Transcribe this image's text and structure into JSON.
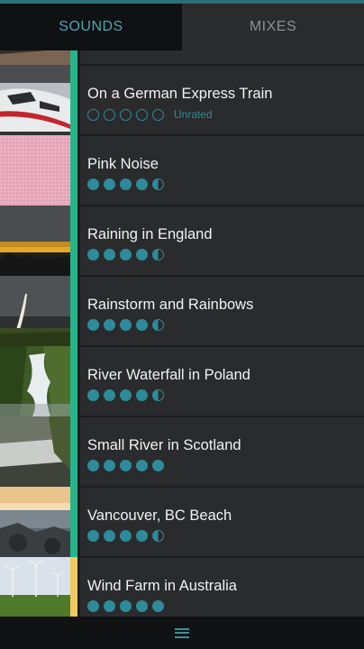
{
  "tabs": {
    "sounds": "SOUNDS",
    "mixes": "MIXES"
  },
  "unrated_label": "Unrated",
  "sounds": [
    {
      "title": "On a German Express Train",
      "rating": [
        0,
        0,
        0,
        0,
        0
      ],
      "unrated": true,
      "bar": "green"
    },
    {
      "title": "Pink Noise",
      "rating": [
        1,
        1,
        1,
        1,
        0.5
      ],
      "unrated": false,
      "bar": "green"
    },
    {
      "title": "Raining in England",
      "rating": [
        1,
        1,
        1,
        1,
        0.5
      ],
      "unrated": false,
      "bar": "green"
    },
    {
      "title": "Rainstorm and Rainbows",
      "rating": [
        1,
        1,
        1,
        1,
        0.5
      ],
      "unrated": false,
      "bar": "green"
    },
    {
      "title": "River Waterfall in Poland",
      "rating": [
        1,
        1,
        1,
        1,
        0.5
      ],
      "unrated": false,
      "bar": "green"
    },
    {
      "title": "Small River in Scotland",
      "rating": [
        1,
        1,
        1,
        1,
        1
      ],
      "unrated": false,
      "bar": "green"
    },
    {
      "title": "Vancouver, BC Beach",
      "rating": [
        1,
        1,
        1,
        1,
        0.5
      ],
      "unrated": false,
      "bar": "green"
    },
    {
      "title": "Wind Farm in Australia",
      "rating": [
        1,
        1,
        1,
        1,
        1
      ],
      "unrated": false,
      "bar": "yellow"
    }
  ],
  "colors": {
    "accent": "#2e8b99",
    "active_bar": "#28b48a",
    "playing_bar": "#f0c860"
  },
  "icons": {
    "menu": "hamburger-menu-icon"
  }
}
